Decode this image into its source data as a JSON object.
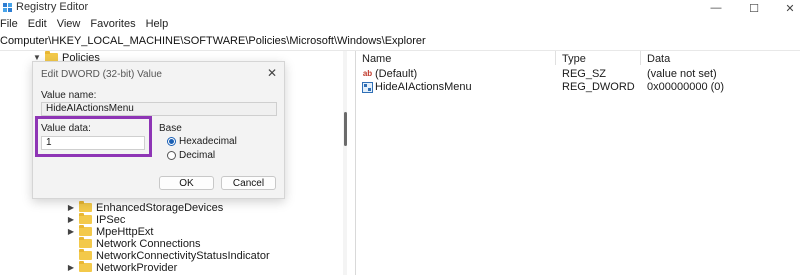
{
  "window": {
    "title": "Registry Editor",
    "minimize_glyph": "—",
    "maximize_glyph": "☐",
    "close_glyph": "✕"
  },
  "menu": [
    "File",
    "Edit",
    "View",
    "Favorites",
    "Help"
  ],
  "address": "Computer\\HKEY_LOCAL_MACHINE\\SOFTWARE\\Policies\\Microsoft\\Windows\\Explorer",
  "tree": {
    "top_item": "Policies",
    "items": [
      "EnhancedStorageDevices",
      "IPSec",
      "MpeHttpExt",
      "Network Connections",
      "NetworkConnectivityStatusIndicator",
      "NetworkProvider"
    ]
  },
  "list": {
    "columns": {
      "name": "Name",
      "type": "Type",
      "data": "Data"
    },
    "rows": [
      {
        "icon": "string-value-icon",
        "name": "(Default)",
        "type": "REG_SZ",
        "data": "(value not set)"
      },
      {
        "icon": "dword-value-icon",
        "name": "HideAIActionsMenu",
        "type": "REG_DWORD",
        "data": "0x00000000 (0)"
      }
    ]
  },
  "dialog": {
    "title": "Edit DWORD (32-bit) Value",
    "value_name_label": "Value name:",
    "value_name": "HideAIActionsMenu",
    "value_data_label": "Value data:",
    "value_data": "1",
    "base_label": "Base",
    "radio_hex": "Hexadecimal",
    "radio_dec": "Decimal",
    "selected_base": "Hexadecimal",
    "ok_label": "OK",
    "cancel_label": "Cancel",
    "highlight_color": "#8e35b5"
  }
}
